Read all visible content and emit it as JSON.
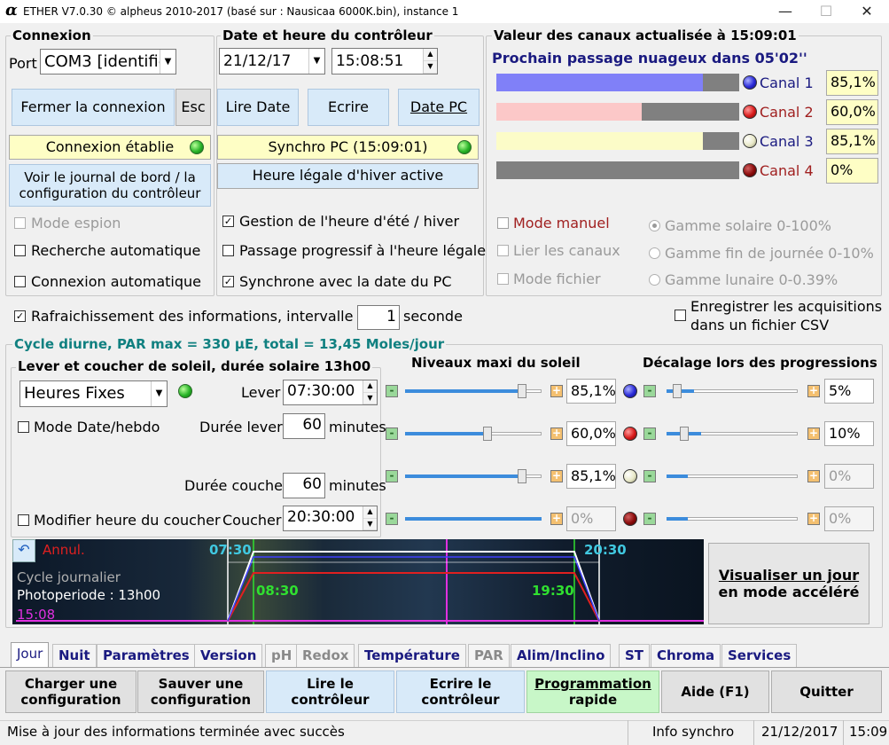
{
  "titlebar": {
    "logo": "α",
    "title": "ETHER V7.0.30  © alpheus 2010-2017 (basé sur : Nausicaa 6000K.bin), instance 1",
    "minimize": "—",
    "maximize": "☐",
    "close": "✕"
  },
  "connexion": {
    "title": "Connexion",
    "port_label": "Port",
    "port_value": "COM3 [identifie",
    "close_btn": "Fermer la connexion",
    "esc_btn": "Esc",
    "status": "Connexion établie",
    "journal_btn_l1": "Voir le journal de bord / la",
    "journal_btn_l2": "configuration du contrôleur",
    "mode_espion": "Mode espion",
    "recherche_auto": "Recherche automatique",
    "connexion_auto": "Connexion automatique"
  },
  "datetime": {
    "title": "Date et heure du contrôleur",
    "date": "21/12/17",
    "time": "15:08:51",
    "read_btn": "Lire Date",
    "write_btn": "Ecrire",
    "pc_btn": "Date PC",
    "synchro": "Synchro PC (15:09:01)",
    "hiver": "Heure légale d'hiver active",
    "gestion": "Gestion de l'heure d'été / hiver",
    "passage": "Passage progressif à l'heure légale",
    "synchrone": "Synchrone avec la date du PC"
  },
  "canaux": {
    "title": "Valeur des canaux actualisée à 15:09:01",
    "subtitle": "Prochain passage nuageux dans 05'02''",
    "channels": [
      {
        "label": "Canal 1",
        "value": "85,1%",
        "level": 85.1,
        "color": "#8080f8"
      },
      {
        "label": "Canal 2",
        "value": "60,0%",
        "level": 60.0,
        "color": "#fcc8c8"
      },
      {
        "label": "Canal 3",
        "value": "85,1%",
        "level": 85.1,
        "color": "#fcfcc8"
      },
      {
        "label": "Canal 4",
        "value": "0%",
        "level": 0,
        "color": "#808080"
      }
    ],
    "mode_manuel": "Mode manuel",
    "lier": "Lier les canaux",
    "mode_fichier": "Mode fichier",
    "gamme_solaire": "Gamme solaire 0-100%",
    "gamme_fin": "Gamme fin de journée 0-10%",
    "gamme_lunaire": "Gamme lunaire 0-0.39%"
  },
  "refresh": {
    "label": "Rafraichissement des informations, intervalle de",
    "value": "1",
    "unit": "seconde",
    "csv_l1": "Enregistrer les acquisitions",
    "csv_l2": "dans un fichier CSV"
  },
  "cycle": {
    "title": "Cycle diurne, PAR max =  330 µE, total = 13,45 Moles/jour",
    "sun_title": "Lever et coucher de soleil, durée solaire 13h00",
    "mode": "Heures Fixes",
    "mode_date": "Mode Date/hebdo",
    "modifier_coucher": "Modifier heure du coucher",
    "lever_label": "Lever",
    "lever": "07:30:00",
    "duree_lever_label": "Durée lever",
    "duree_lever": "60",
    "minutes": "minutes",
    "duree_coucher_label": "Durée coucher",
    "duree_coucher": "60",
    "coucher_label": "Coucher",
    "coucher": "20:30:00",
    "niveaux_title": "Niveaux maxi du soleil",
    "decalage_title": "Décalage lors des progressions",
    "niveaux": [
      "85,1%",
      "60,0%",
      "85,1%",
      "0%"
    ],
    "niveaux_level": [
      85.1,
      60.0,
      85.1,
      100
    ],
    "decalages": [
      "5%",
      "10%",
      "0%",
      "0%"
    ],
    "decalages_level": [
      5,
      10,
      0,
      0
    ]
  },
  "graph": {
    "annul": "Annul.",
    "cycle": "Cycle journalier",
    "photo": "Photoperiode : 13h00",
    "now": "15:08",
    "t1": "07:30",
    "t2": "08:30",
    "t3": "19:30",
    "t4": "20:30"
  },
  "visualiser_l1": "Visualiser un jour",
  "visualiser_l2": "en mode accéléré",
  "tabs": [
    "Jour",
    "Nuit",
    "Paramètres",
    "Version",
    "pH",
    "Redox",
    "Température",
    "PAR",
    "Alim/Inclino",
    "ST",
    "Chroma",
    "Services"
  ],
  "bottom": {
    "charger_l1": "Charger une",
    "charger_l2": "configuration",
    "sauver_l1": "Sauver une",
    "sauver_l2": "configuration",
    "lire_l1": "Lire le",
    "lire_l2": "contrôleur",
    "ecrire_l1": "Ecrire le",
    "ecrire_l2": "contrôleur",
    "prog_l1": "Programmation",
    "prog_l2": "rapide",
    "aide": "Aide (F1)",
    "quitter": "Quitter"
  },
  "statusbar": {
    "message": "Mise à jour des informations terminée avec succès",
    "info": "Info synchro",
    "date": "21/12/2017",
    "time": "15:09"
  }
}
